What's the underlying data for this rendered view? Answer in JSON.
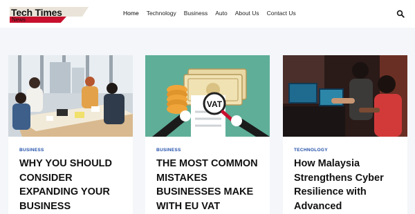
{
  "site": {
    "title": "Tech Times",
    "subtitle": "News"
  },
  "nav": {
    "items": [
      "Home",
      "Technology",
      "Business",
      "Auto",
      "About Us",
      "Contact Us"
    ],
    "active": "Home"
  },
  "search": {
    "icon": "search-icon"
  },
  "colors": {
    "brand_red": "#c8102e",
    "category_blue": "#1f4ea8",
    "background": "#f4f6f9"
  },
  "cards": [
    {
      "category": "BUSINESS",
      "title": "WHY YOU SHOULD CONSIDER EXPANDING YOUR BUSINESS",
      "image": "office-meeting-photo"
    },
    {
      "category": "BUSINESS",
      "title": "THE MOST COMMON MISTAKES BUSINESSES MAKE WITH EU VAT",
      "image": "vat-illustration",
      "image_text": "VAT"
    },
    {
      "category": "TECHNOLOGY",
      "title": "How Malaysia Strengthens Cyber Resilience with Advanced",
      "image": "cyber-team-photo"
    }
  ]
}
